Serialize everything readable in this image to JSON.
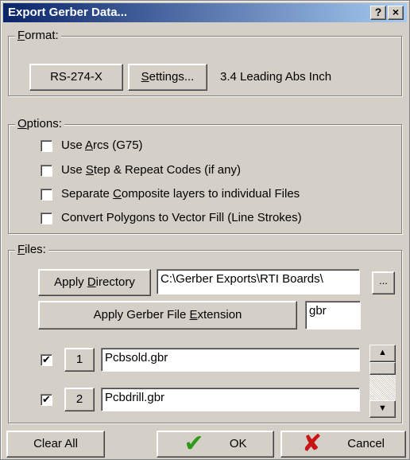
{
  "window": {
    "title": "Export Gerber Data...",
    "help_glyph": "?",
    "close_glyph": "×"
  },
  "format": {
    "group_label_hotkey": "F",
    "group_label_rest": "ormat:",
    "rs274x_label": "RS-274-X",
    "settings_hotkey": "S",
    "settings_rest": "ettings...",
    "format_info": "3.4 Leading Abs Inch"
  },
  "options": {
    "group_label_hotkey": "O",
    "group_label_rest": "ptions:",
    "items": [
      {
        "pre": "Use ",
        "hotkey": "A",
        "post": "rcs (G75)",
        "checked": false,
        "mark": ""
      },
      {
        "pre": "Use ",
        "hotkey": "S",
        "post": "tep & Repeat Codes (if any)",
        "checked": false,
        "mark": ""
      },
      {
        "pre": "Separate ",
        "hotkey": "C",
        "post": "omposite layers to individual Files",
        "checked": false,
        "mark": ""
      },
      {
        "pre": "Convert Polygons to Vector Fill (Line Strokes)",
        "hotkey": "",
        "post": "",
        "checked": false,
        "mark": ""
      }
    ]
  },
  "files": {
    "group_label_hotkey": "F",
    "group_label_rest": "iles:",
    "apply_directory_pre": "Apply ",
    "apply_directory_hotkey": "D",
    "apply_directory_post": "irectory",
    "directory_value": "C:\\Gerber Exports\\RTI Boards\\",
    "browse_label": "...",
    "apply_ext_pre": "Apply Gerber File ",
    "apply_ext_hotkey": "E",
    "apply_ext_post": "xtension",
    "extension_value": "gbr",
    "rows": [
      {
        "checked": true,
        "mark": "✔",
        "number": "1",
        "filename": "Pcbsold.gbr"
      },
      {
        "checked": true,
        "mark": "✔",
        "number": "2",
        "filename": "Pcbdrill.gbr"
      }
    ],
    "scroll_up_glyph": "▲",
    "scroll_down_glyph": "▼"
  },
  "footer": {
    "clear_all_label": "Clear All",
    "ok_icon": "green-check-icon",
    "ok_glyph": "✔",
    "ok_label": "OK",
    "cancel_icon": "red-x-icon",
    "cancel_glyph": "✘",
    "cancel_label": "Cancel"
  }
}
